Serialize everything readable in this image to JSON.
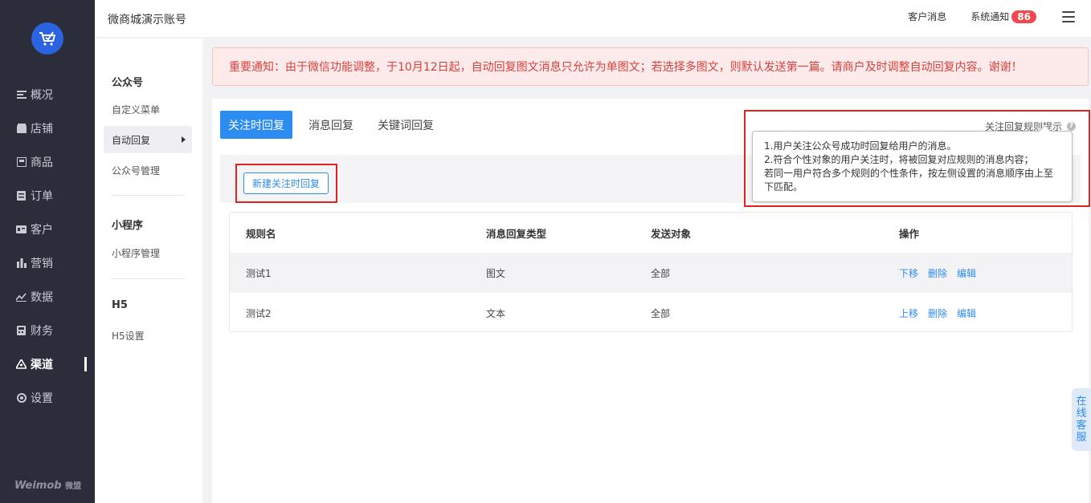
{
  "sidebar": {
    "items": [
      {
        "icon": "overview-icon",
        "label": "概况"
      },
      {
        "icon": "store-icon",
        "label": "店铺"
      },
      {
        "icon": "goods-icon",
        "label": "商品"
      },
      {
        "icon": "order-icon",
        "label": "订单"
      },
      {
        "icon": "customer-icon",
        "label": "客户"
      },
      {
        "icon": "marketing-icon",
        "label": "营销"
      },
      {
        "icon": "data-icon",
        "label": "数据"
      },
      {
        "icon": "finance-icon",
        "label": "财务"
      },
      {
        "icon": "channel-icon",
        "label": "渠道"
      },
      {
        "icon": "settings-icon",
        "label": "设置"
      }
    ],
    "active": "渠道",
    "brand": "Weimob",
    "brand_cn": "微盟"
  },
  "header": {
    "store_name": "微商城演示账号",
    "customer_msg": "客户消息",
    "system_notice": "系统通知",
    "notice_count": "86"
  },
  "subnav": {
    "group1": "公众号",
    "group1_items": [
      "自定义菜单",
      "自动回复",
      "公众号管理"
    ],
    "group2": "小程序",
    "group2_items": [
      "小程序管理"
    ],
    "group3": "H5",
    "group3_items": [
      "H5设置"
    ]
  },
  "notice": {
    "text": "重要通知：由于微信功能调整，于10月12日起，自动回复图文消息只允许为单图文；若选择多图文，则默认发送第一篇。请商户及时调整自动回复内容。谢谢！"
  },
  "tabs": [
    "关注时回复",
    "消息回复",
    "关键词回复"
  ],
  "rule_hint": "关注回复规则提示",
  "tooltip": {
    "line1": "1.用户关注公众号成功时回复给用户的消息。",
    "line2": "2.符合个性对象的用户关注时，将被回复对应规则的消息内容；",
    "line3": "若同一用户符合多个规则的个性条件，按左侧设置的消息顺序由上至下匹配。"
  },
  "new_button": "新建关注时回复",
  "table": {
    "headers": [
      "规则名",
      "消息回复类型",
      "发送对象",
      "操作"
    ],
    "rows": [
      {
        "name": "测试1",
        "type": "图文",
        "target": "全部",
        "ops": [
          "下移",
          "删除",
          "编辑"
        ]
      },
      {
        "name": "测试2",
        "type": "文本",
        "target": "全部",
        "ops": [
          "上移",
          "删除",
          "编辑"
        ]
      }
    ]
  },
  "service": "在线客服",
  "colors": {
    "primary": "#2d8cf0",
    "sidebar_bg": "#2b2d3b",
    "notice_text": "#d9403c",
    "badge": "#f2474f",
    "highlight_box": "#e0231f"
  }
}
